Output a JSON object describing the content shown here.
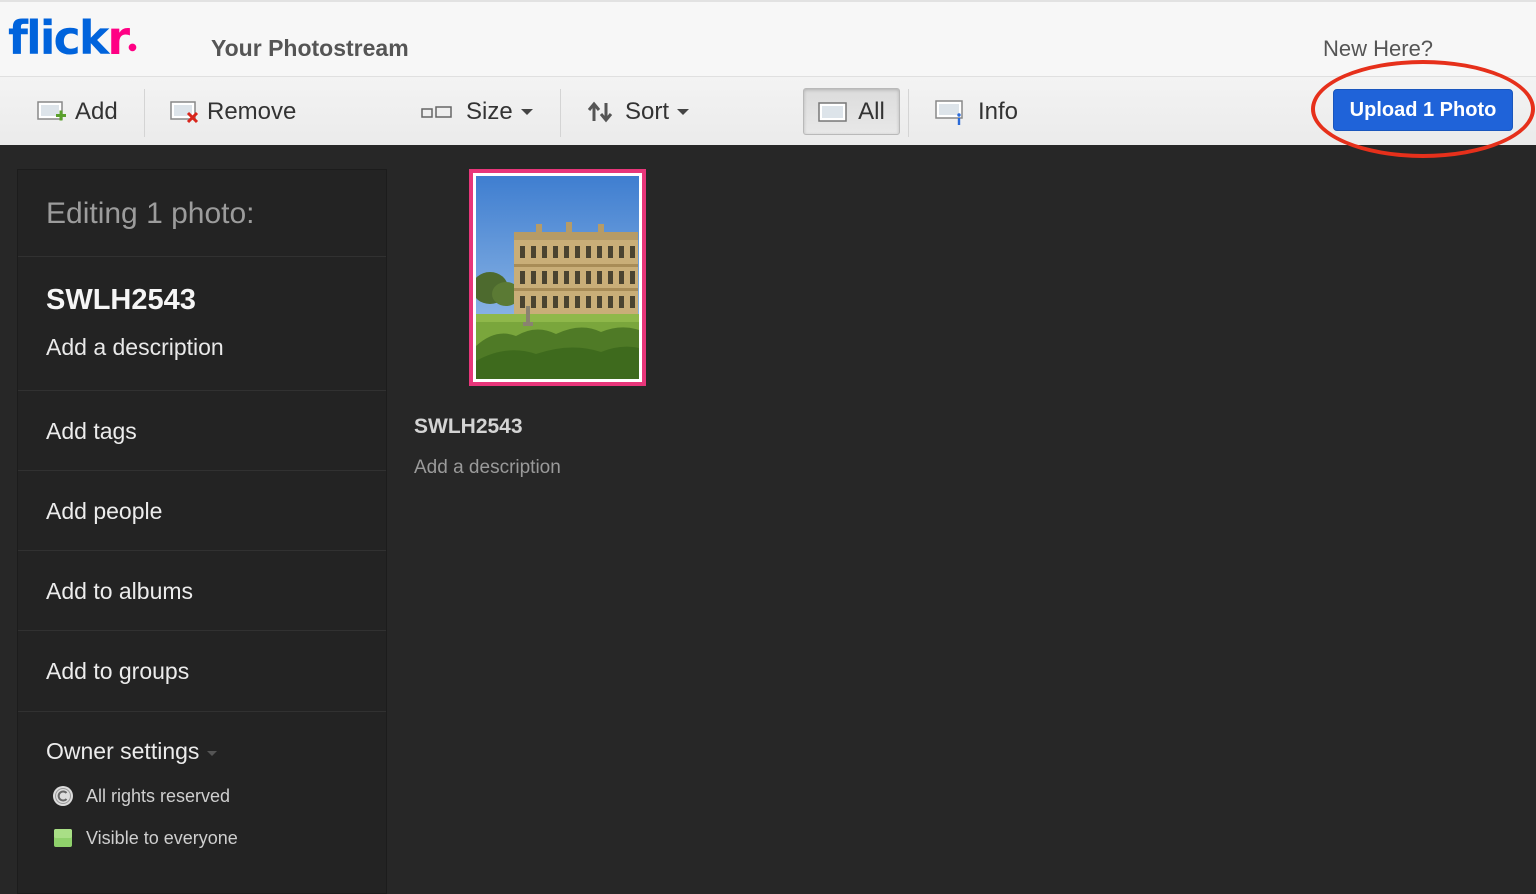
{
  "header": {
    "logo": {
      "main": "flick",
      "accent": "r",
      "brand_colors": {
        "blue": "#0063dc",
        "pink": "#ff0084"
      }
    },
    "title": "Your Photostream",
    "new_here": "New Here?"
  },
  "toolbar": {
    "add_label": "Add",
    "remove_label": "Remove",
    "size_label": "Size",
    "sort_label": "Sort",
    "all_label": "All",
    "info_label": "Info",
    "upload_label": "Upload 1 Photo",
    "upload_color": "#1f63d9",
    "highlight_color": "#e6301b"
  },
  "sidebar": {
    "heading": "Editing 1 photo:",
    "photo_title": "SWLH2543",
    "description_placeholder": "Add a description",
    "items": [
      {
        "label": "Add tags"
      },
      {
        "label": "Add people"
      },
      {
        "label": "Add to albums"
      },
      {
        "label": "Add to groups"
      }
    ],
    "owner_settings": {
      "label": "Owner settings",
      "license": "All rights reserved",
      "visibility": "Visible to everyone"
    }
  },
  "main": {
    "photo": {
      "title": "SWLH2543",
      "description_placeholder": "Add a description",
      "selected_border_color": "#e8367a",
      "image_subject": "stately-home-photo"
    }
  }
}
